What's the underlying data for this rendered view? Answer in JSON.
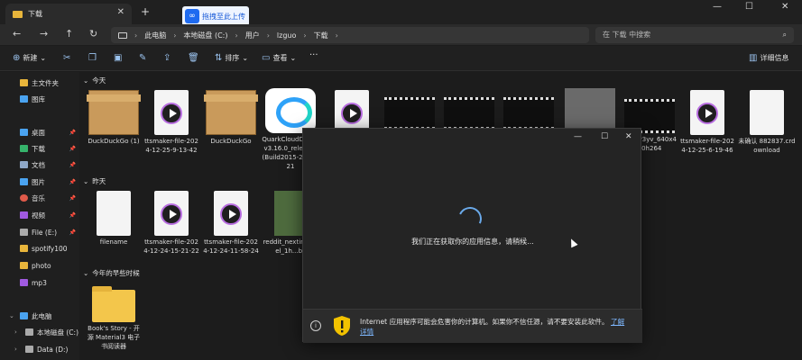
{
  "titlebar": {
    "tab_title": "下载",
    "tab_close": "✕",
    "new_tab": "+",
    "baidu_badge": "拖拽至此上传",
    "baidu_logo": "∞",
    "minimize": "—",
    "maximize": "☐",
    "close": "✕"
  },
  "nav": {
    "back": "←",
    "forward": "→",
    "up": "↑",
    "refresh": "↻",
    "breadcrumb": [
      "此电脑",
      "本地磁盘 (C:)",
      "用户",
      "lzguo",
      "下载"
    ],
    "search_placeholder": "在 下载 中搜索",
    "search_icon": "⌕"
  },
  "toolbar": {
    "new_label": "新建",
    "sort_label": "排序",
    "view_label": "查看",
    "more_label": "···",
    "details_label": "详细信息",
    "icons": [
      "cut-icon",
      "copy-icon",
      "paste-icon",
      "rename-icon",
      "share-icon",
      "delete-icon"
    ]
  },
  "sidebar": {
    "items": [
      {
        "label": "主文件夹",
        "color": "#e8b53b"
      },
      {
        "label": "图库",
        "color": "#4aa3f0"
      },
      {
        "label": "桌面",
        "color": "#4aa3f0",
        "pinned": true
      },
      {
        "label": "下载",
        "color": "#36b36b",
        "pinned": true
      },
      {
        "label": "文档",
        "color": "#8fa8c8",
        "pinned": true
      },
      {
        "label": "图片",
        "color": "#4aa3f0",
        "pinned": true
      },
      {
        "label": "音乐",
        "color": "#e05a4a",
        "pinned": true
      },
      {
        "label": "视频",
        "color": "#a05ae0",
        "pinned": true
      },
      {
        "label": "File (E:)",
        "color": "#aaaaaa",
        "pinned": true
      },
      {
        "label": "spotify100",
        "color": "#e8b53b"
      },
      {
        "label": "photo",
        "color": "#e8b53b"
      },
      {
        "label": "mp3",
        "color": "#a05ae0"
      },
      {
        "label": "此电脑",
        "color": "#4aa3f0"
      },
      {
        "label": "本地磁盘 (C:)",
        "color": "#aaaaaa"
      },
      {
        "label": "Data (D:)",
        "color": "#aaaaaa"
      }
    ]
  },
  "groups": {
    "today": "今天",
    "yesterday": "昨天",
    "earlier": "今年的早些时候"
  },
  "files_today": [
    {
      "name": "DuckDuckGo (1)",
      "kind": "box"
    },
    {
      "name": "ttsmaker-file-2024-12-25-9-13-42",
      "kind": "video"
    },
    {
      "name": "DuckDuckGo",
      "kind": "box"
    },
    {
      "name": "QuarkCloudDrive_v3.16.0_release_(Build2015-2024121",
      "kind": "cloud"
    },
    {
      "name": "",
      "kind": "video"
    },
    {
      "name": "",
      "kind": "film"
    },
    {
      "name": "",
      "kind": "film"
    },
    {
      "name": "",
      "kind": "film"
    },
    {
      "name": "",
      "kind": "photo"
    },
    {
      "name": "be_fPr3yv_640x480h264",
      "kind": "film"
    },
    {
      "name": "ttsmaker-file-2024-12-25-6-19-46",
      "kind": "video"
    },
    {
      "name": "未确认 882837.crdownload",
      "kind": "doc"
    }
  ],
  "files_yesterday": [
    {
      "name": "filename",
      "kind": "doc"
    },
    {
      "name": "ttsmaker-file-2024-12-24-15-21-22",
      "kind": "video"
    },
    {
      "name": "ttsmaker-file-2024-12-24-11-58-24",
      "kind": "video"
    },
    {
      "name": "reddit_nextinglevel_1h...bz",
      "kind": "photo"
    }
  ],
  "files_earlier": [
    {
      "name": "Book's Story - 开源 Material3 电子书阅读器",
      "kind": "folder"
    }
  ],
  "dialog": {
    "minimize": "—",
    "maximize": "☐",
    "close": "✕",
    "message": "我们正在获取你的应用信息，请稍候...",
    "info_icon": "i",
    "warning": "Internet 应用程序可能会危害你的计算机。如果你不信任源，请不要安装此软件。",
    "link": "了解详情"
  }
}
